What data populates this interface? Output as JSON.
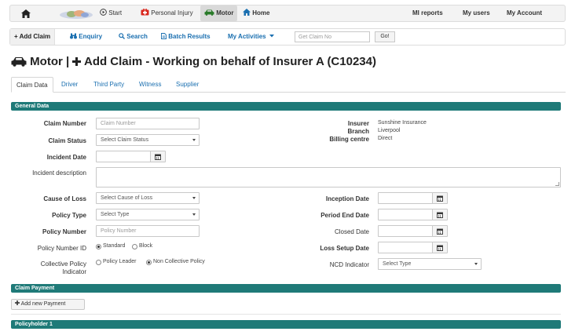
{
  "topnav": {
    "start": "Start",
    "personal_injury": "Personal Injury",
    "motor": "Motor",
    "home": "Home",
    "mi_reports": "MI reports",
    "my_users": "My users",
    "my_account": "My Account"
  },
  "subnav": {
    "add_claim": "+ Add Claim",
    "enquiry": "Enquiry",
    "search": "Search",
    "batch_results": "Batch Results",
    "my_activities": "My Activities",
    "claim_no_placeholder": "Get Claim No",
    "go": "Go!"
  },
  "page_title": "Motor | ",
  "page_title_rest": "Add Claim - Working on behalf of Insurer A (C10234)",
  "tabs": [
    "Claim Data",
    "Driver",
    "Third Party",
    "Witness",
    "Supplier"
  ],
  "sections": {
    "general": "General Data",
    "claim_payment": "Claim Payment",
    "policyholder": "Policyholder 1"
  },
  "form": {
    "claim_number_label": "Claim Number",
    "claim_number_placeholder": "Claim Number",
    "claim_status_label": "Claim Status",
    "claim_status_value": "Select Claim Status",
    "incident_date_label": "Incident Date",
    "incident_desc_label": "Incident description",
    "cause_of_loss_label": "Cause of Loss",
    "cause_of_loss_value": "Select Cause of Loss",
    "policy_type_label": "Policy Type",
    "policy_type_value": "Select Type",
    "policy_number_label": "Policy Number",
    "policy_number_placeholder": "Policy Number",
    "policy_number_id_label": "Policy Number ID",
    "pnid_standard": "Standard",
    "pnid_block": "Block",
    "collective_policy_label_1": "Collective Policy",
    "collective_policy_label_2": "Indicator",
    "cp_leader": "Policy Leader",
    "cp_non": "Non Collective Policy",
    "insurer_label": "Insurer",
    "insurer_value": "Sunshine Insurance",
    "branch_label": "Branch",
    "branch_value": "Liverpool",
    "billing_label": "Billing centre",
    "billing_value": "Direct",
    "inception_label": "Inception Date",
    "period_end_label": "Period End Date",
    "closed_label": "Closed Date",
    "loss_setup_label": "Loss Setup Date",
    "ncd_label": "NCD Indicator",
    "ncd_value": "Select Type"
  },
  "buttons": {
    "add_payment": "Add new Payment"
  },
  "colors": {
    "section_bg": "#1f7a78",
    "link": "#1a6fb0"
  }
}
